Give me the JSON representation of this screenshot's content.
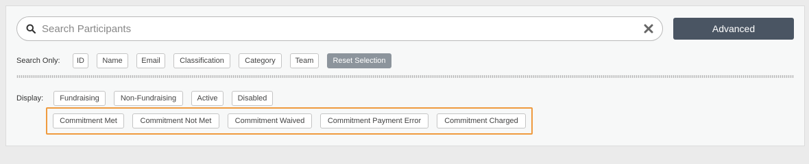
{
  "search": {
    "placeholder": "Search Participants",
    "value": "",
    "advanced_label": "Advanced"
  },
  "search_only": {
    "label": "Search Only:",
    "chips": [
      "ID",
      "Name",
      "Email",
      "Classification",
      "Category",
      "Team"
    ],
    "reset_label": "Reset Selection"
  },
  "display": {
    "label": "Display:",
    "chips": [
      "Fundraising",
      "Non-Fundraising",
      "Active",
      "Disabled"
    ],
    "commitment_chips": [
      "Commitment Met",
      "Commitment Not Met",
      "Commitment Waived",
      "Commitment Payment Error",
      "Commitment Charged"
    ]
  },
  "colors": {
    "accent_button": "#4a5563",
    "reset_chip": "#8c949c",
    "highlight_border": "#ef9a3e"
  },
  "icons": {
    "search": "search-icon",
    "clear": "close-icon"
  }
}
